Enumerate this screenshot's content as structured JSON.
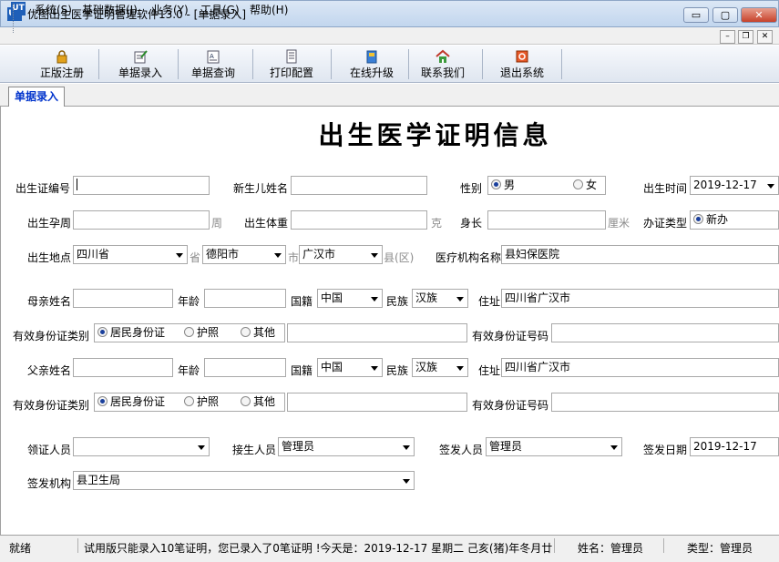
{
  "window": {
    "title": "优图出生医学证明管理软件13.0 - [单据录入]",
    "app_icon": "UT",
    "min": "▭",
    "max": "▢",
    "close": "✕"
  },
  "menu": {
    "items": [
      "系统(S)",
      "基础数据(J)",
      "业务(Y)",
      "工具(G)",
      "帮助(H)"
    ],
    "mdi_min": "–",
    "mdi_restore": "❐",
    "mdi_close": "✕"
  },
  "toolbar": {
    "items": [
      {
        "label": "正版注册",
        "icon": "lock-icon"
      },
      {
        "label": "单据录入",
        "icon": "edit-doc-icon"
      },
      {
        "label": "单据查询",
        "icon": "query-doc-icon"
      },
      {
        "label": "打印配置",
        "icon": "print-config-icon"
      },
      {
        "label": "在线升级",
        "icon": "upgrade-icon"
      },
      {
        "label": "联系我们",
        "icon": "home-icon"
      },
      {
        "label": "退出系统",
        "icon": "exit-icon"
      }
    ]
  },
  "tab": {
    "label": "单据录入"
  },
  "form": {
    "title": "出生医学证明信息",
    "birth_cert_no": {
      "label": "出生证编号",
      "value": ""
    },
    "baby_name": {
      "label": "新生儿姓名",
      "value": ""
    },
    "gender": {
      "label": "性别",
      "options": [
        "男",
        "女"
      ],
      "selected": "男"
    },
    "birth_time": {
      "label": "出生时间",
      "value": "2019-12-17"
    },
    "gestation": {
      "label": "出生孕周",
      "unit": "周",
      "value": ""
    },
    "weight": {
      "label": "出生体重",
      "unit": "克",
      "value": ""
    },
    "length": {
      "label": "身长",
      "unit": "厘米",
      "value": ""
    },
    "cert_type": {
      "label": "办证类型",
      "selected": "新办"
    },
    "birthplace": {
      "label": "出生地点",
      "province": "四川省",
      "province_unit": "省",
      "city": "德阳市",
      "city_unit": "市",
      "county": "广汉市",
      "county_unit": "县(区)"
    },
    "hospital": {
      "label": "医疗机构名称",
      "value": "县妇保医院"
    },
    "mother": {
      "name_label": "母亲姓名",
      "name": "",
      "age_label": "年龄",
      "age": "",
      "nationality_label": "国籍",
      "nationality": "中国",
      "ethnic_label": "民族",
      "ethnic": "汉族",
      "address_label": "住址",
      "address": "四川省广汉市",
      "id_type_label": "有效身份证类别",
      "id_types": [
        "居民身份证",
        "护照",
        "其他"
      ],
      "id_type_selected": "居民身份证",
      "id_no_label": "有效身份证号码",
      "id_no": ""
    },
    "father": {
      "name_label": "父亲姓名",
      "name": "",
      "age_label": "年龄",
      "age": "",
      "nationality_label": "国籍",
      "nationality": "中国",
      "ethnic_label": "民族",
      "ethnic": "汉族",
      "address_label": "住址",
      "address": "四川省广汉市",
      "id_type_label": "有效身份证类别",
      "id_types": [
        "居民身份证",
        "护照",
        "其他"
      ],
      "id_type_selected": "居民身份证",
      "id_no_label": "有效身份证号码",
      "id_no": ""
    },
    "receiver": {
      "label": "领证人员",
      "value": ""
    },
    "deliverer": {
      "label": "接生人员",
      "value": "管理员"
    },
    "issuer": {
      "label": "签发人员",
      "value": "管理员"
    },
    "issue_date": {
      "label": "签发日期",
      "value": "2019-12-17"
    },
    "issue_org": {
      "label": "签发机构",
      "value": "县卫生局"
    }
  },
  "status": {
    "state": "就绪",
    "message": "试用版只能录入10笔证明，您已录入了0笔证明 !今天是：2019-12-17 星期二 己亥(猪)年冬月廿二",
    "user": "姓名：管理员",
    "type": "类型：管理员"
  }
}
